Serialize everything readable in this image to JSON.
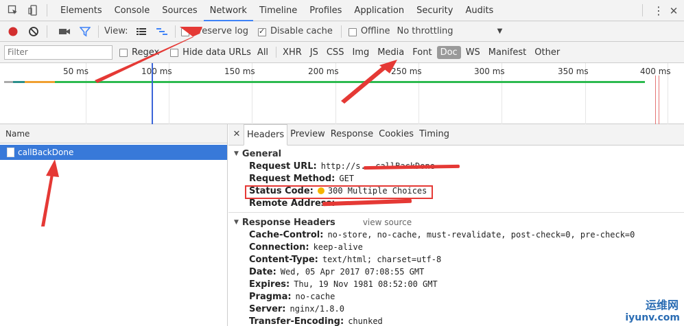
{
  "tabbar": {
    "tabs": [
      "Elements",
      "Console",
      "Sources",
      "Network",
      "Timeline",
      "Profiles",
      "Application",
      "Security",
      "Audits"
    ],
    "active_tab": "Network",
    "kebab": "⋮",
    "close": "✕"
  },
  "toolbar": {
    "view_label": "View:",
    "preserve_log": "Preserve log",
    "disable_cache": "Disable cache",
    "offline": "Offline",
    "throttling": "No throttling"
  },
  "filterbar": {
    "placeholder": "Filter",
    "regex": "Regex",
    "hide_data_urls": "Hide data URLs",
    "types": [
      "All",
      "XHR",
      "JS",
      "CSS",
      "Img",
      "Media",
      "Font",
      "Doc",
      "WS",
      "Manifest",
      "Other"
    ],
    "active_type": "Doc"
  },
  "overview": {
    "ticks": [
      "50 ms",
      "100 ms",
      "150 ms",
      "200 ms",
      "250 ms",
      "300 ms",
      "350 ms",
      "400 ms"
    ]
  },
  "requests": {
    "header": "Name",
    "items": [
      {
        "name": "callBackDone"
      }
    ]
  },
  "details": {
    "close": "✕",
    "tabs": [
      "Headers",
      "Preview",
      "Response",
      "Cookies",
      "Timing"
    ],
    "active_tab": "Headers",
    "general": {
      "title": "General",
      "rows": [
        {
          "key": "Request URL:",
          "value": "http://s...callBackDone"
        },
        {
          "key": "Request Method:",
          "value": "GET"
        },
        {
          "key": "Status Code:",
          "value": "300 Multiple Choices"
        },
        {
          "key": "Remote Address:",
          "value": ""
        }
      ]
    },
    "response_headers": {
      "title": "Response Headers",
      "view_source": "view source",
      "rows": [
        {
          "key": "Cache-Control:",
          "value": "no-store, no-cache, must-revalidate, post-check=0, pre-check=0"
        },
        {
          "key": "Connection:",
          "value": "keep-alive"
        },
        {
          "key": "Content-Type:",
          "value": "text/html; charset=utf-8"
        },
        {
          "key": "Date:",
          "value": "Wed, 05 Apr 2017 07:08:55 GMT"
        },
        {
          "key": "Expires:",
          "value": "Thu, 19 Nov 1981 08:52:00 GMT"
        },
        {
          "key": "Pragma:",
          "value": "no-cache"
        },
        {
          "key": "Server:",
          "value": "nginx/1.8.0"
        },
        {
          "key": "Transfer-Encoding:",
          "value": "chunked"
        }
      ]
    }
  },
  "watermark": {
    "cn": "运维网",
    "en": "iyunv.com"
  },
  "colors": {
    "accent": "#3e82f7",
    "selected_row": "#3879d9",
    "record": "#d32f2f",
    "annotation": "#e53935",
    "status_dot": "#f5b400"
  }
}
